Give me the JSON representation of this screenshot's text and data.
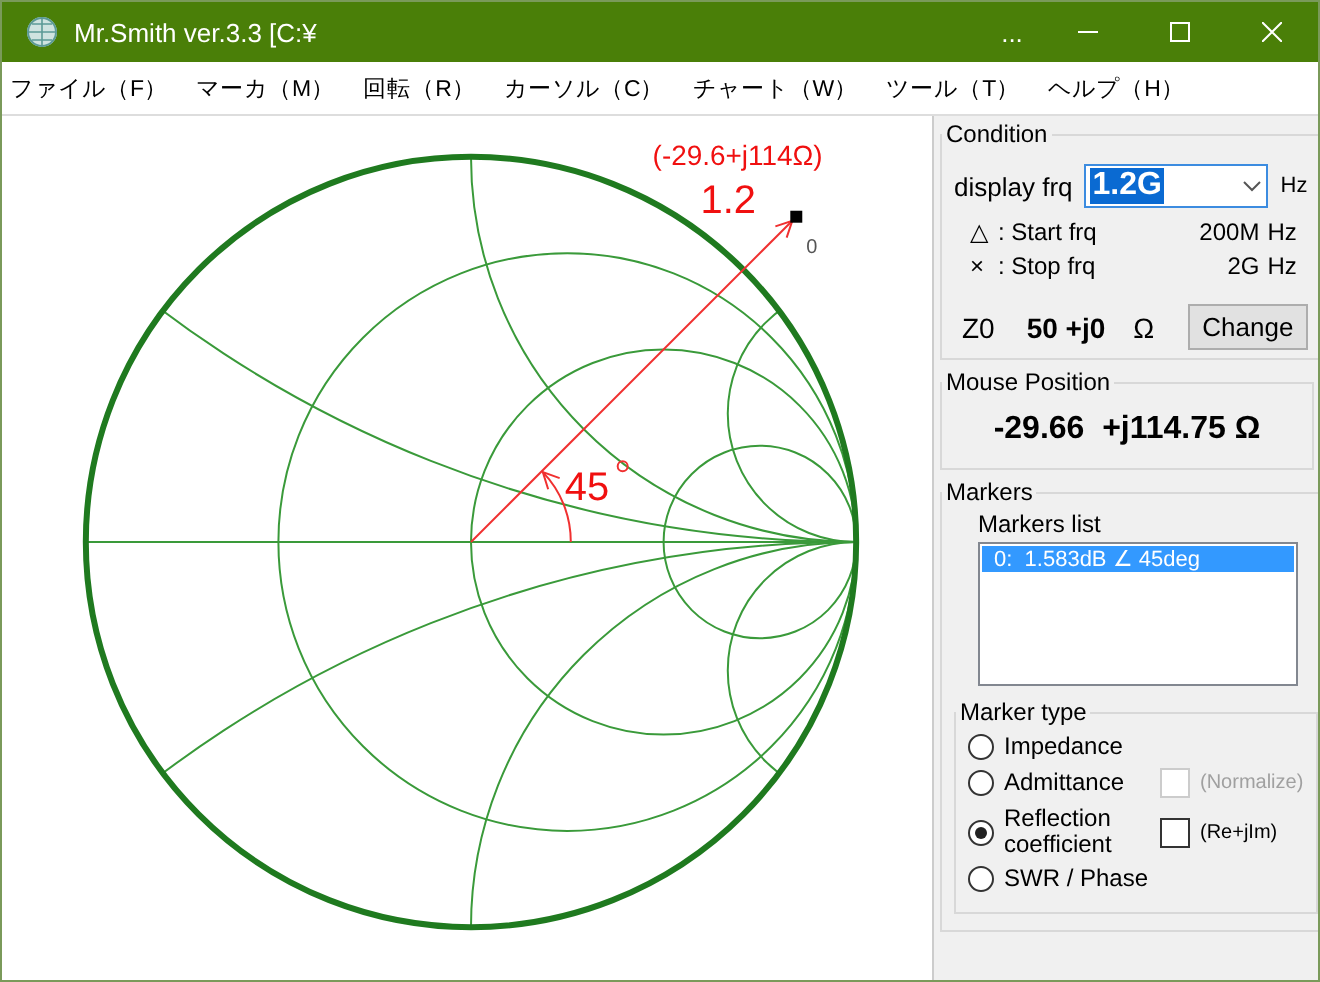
{
  "window": {
    "title": "Mr.Smith ver.3.3 [C:¥",
    "extra": "..."
  },
  "menu": [
    "ファイル（F）",
    "マーカ（M）",
    "回転（R）",
    "カーソル（C）",
    "チャート（W）",
    "ツール（T）",
    "ヘルプ（H）"
  ],
  "chart": {
    "impedance_label": "(-29.6+j114Ω)",
    "frequency_label": "1.2",
    "marker_index": "0",
    "angle_label": "45"
  },
  "condition": {
    "title": "Condition",
    "display": {
      "label": "display frq",
      "value": "1.2G",
      "unit": "Hz"
    },
    "range": [
      {
        "symbol": "△",
        "label": ": Start frq",
        "value": "200M",
        "unit": "Hz"
      },
      {
        "symbol": "×",
        "label": ": Stop frq",
        "value": "2G",
        "unit": "Hz"
      }
    ],
    "z0": {
      "label": "Z0",
      "value": "50 +j0",
      "unit": "Ω",
      "button": "Change"
    }
  },
  "mouse_position": {
    "title": "Mouse Position",
    "value": "-29.66  +j114.75 Ω"
  },
  "markers": {
    "title": "Markers",
    "list_title": "Markers list",
    "items": [
      {
        "text": "0:  1.583dB ∠ 45deg",
        "selected": true
      }
    ],
    "marker_type": {
      "title": "Marker type",
      "options": [
        {
          "label": "Impedance",
          "selected": false
        },
        {
          "label": "Admittance",
          "selected": false
        },
        {
          "label": "Reflection coefficient",
          "selected": true
        },
        {
          "label": "SWR / Phase",
          "selected": false
        }
      ],
      "normalize": {
        "label": "(Normalize)",
        "checked": false,
        "disabled": true
      },
      "re_im": {
        "label": "(Re+jIm)",
        "checked": false,
        "disabled": false
      }
    }
  }
}
